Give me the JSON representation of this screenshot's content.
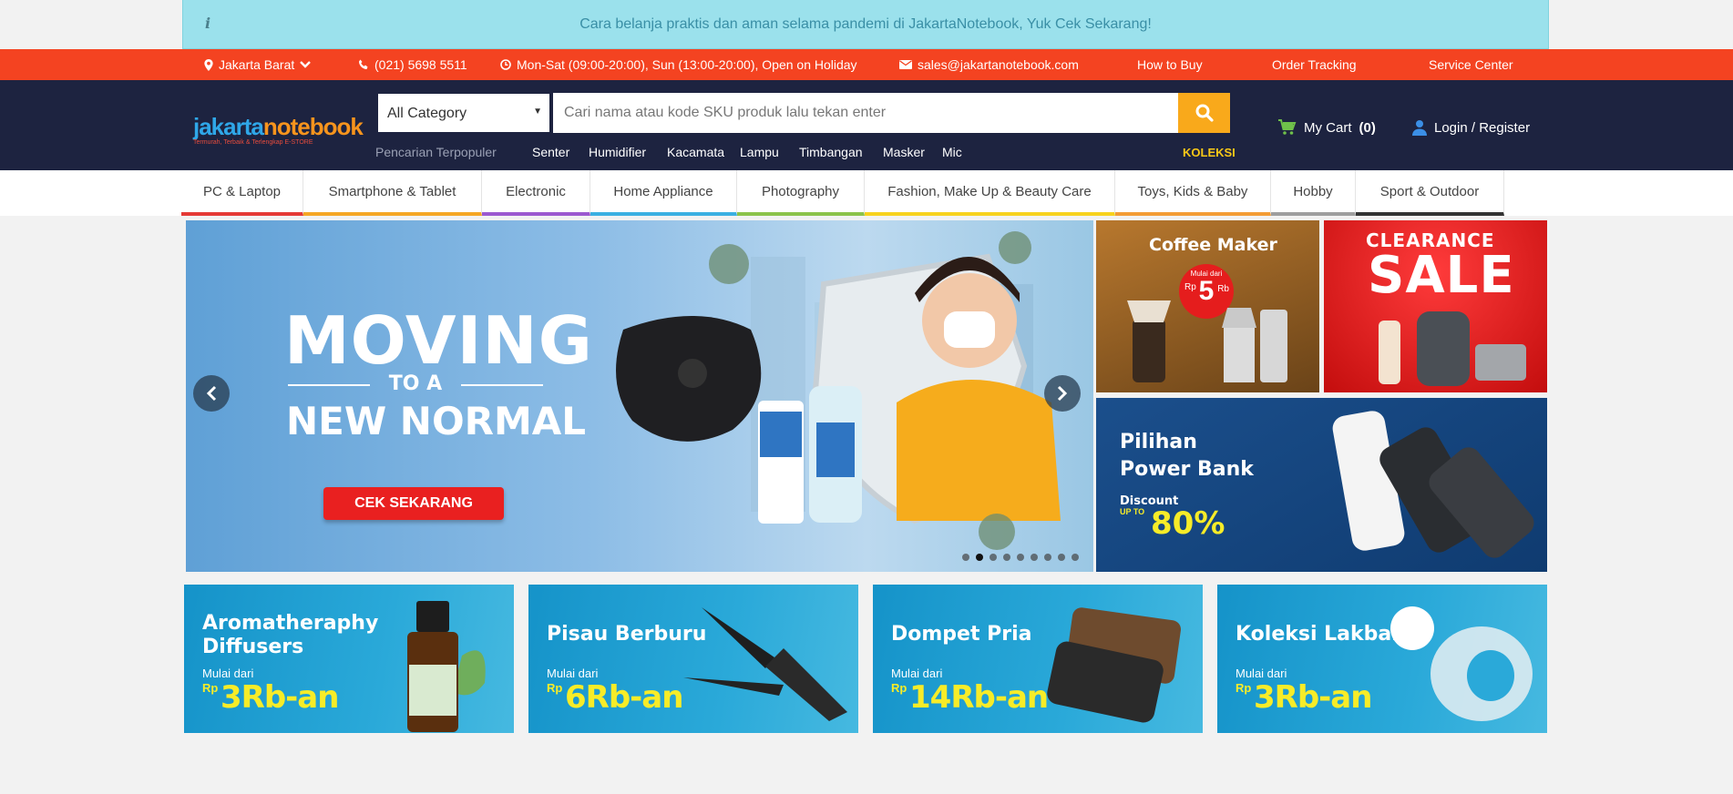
{
  "notice": {
    "info_icon": "i",
    "message": "Cara belanja praktis dan aman selama pandemi di JakartaNotebook, Yuk Cek Sekarang!"
  },
  "topbar": {
    "location": "Jakarta Barat",
    "phone": "(021) 5698 5511",
    "hours": "Mon-Sat (09:00-20:00), Sun (13:00-20:00), Open on Holiday",
    "email": "sales@jakartanotebook.com",
    "links": [
      "How to Buy",
      "Order Tracking",
      "Service Center"
    ]
  },
  "header": {
    "logo_part1": "jakarta",
    "logo_part2": "notebook",
    "logo_tagline": "Termurah, Terbaik & Terlengkap E-STORE",
    "category_selected": "All Category",
    "search_placeholder": "Cari nama atau kode SKU produk lalu tekan enter",
    "popular_label": "Pencarian Terpopuler",
    "popular_items": [
      "Senter",
      "Humidifier",
      "Kacamata",
      "Lampu",
      "Timbangan",
      "Masker",
      "Mic"
    ],
    "koleksi": "KOLEKSI",
    "cart": "My Cart",
    "cart_count": "(0)",
    "login": "Login / Register"
  },
  "nav": {
    "tabs": [
      {
        "label": "PC & Laptop",
        "color": "#e53935"
      },
      {
        "label": "Smartphone & Tablet",
        "color": "#f5a623"
      },
      {
        "label": "Electronic",
        "color": "#9b59d0"
      },
      {
        "label": "Home Appliance",
        "color": "#3ab0e2"
      },
      {
        "label": "Photography",
        "color": "#8bc34a"
      },
      {
        "label": "Fashion, Make Up & Beauty Care",
        "color": "#f7d21c"
      },
      {
        "label": "Toys, Kids & Baby",
        "color": "#f39c34"
      },
      {
        "label": "Hobby",
        "color": "#9e9e9e"
      },
      {
        "label": "Sport & Outdoor",
        "color": "#333333"
      }
    ]
  },
  "hero": {
    "line1": "MOVING",
    "line2": "TO A",
    "line3": "NEW NORMAL",
    "cta": "CEK SEKARANG",
    "slide_count": 9,
    "active_slide": 2
  },
  "side_banners": {
    "coffee": {
      "title": "Coffee Maker",
      "badge_top": "Mulai dari",
      "badge_rp": "Rp",
      "badge_val": "5",
      "badge_unit": "Rb"
    },
    "clearance": {
      "line1": "CLEARANCE",
      "line2": "SALE"
    },
    "powerbank": {
      "line1": "Pilihan",
      "line2": "Power Bank",
      "disc_label": "Discount",
      "upto": "UP TO",
      "disc_val": "80%"
    }
  },
  "promos": [
    {
      "title1": "Aromatheraphy",
      "title2": "Diffusers",
      "mulai": "Mulai dari",
      "rp": "Rp",
      "price": "3Rb-an"
    },
    {
      "title1": "Pisau Berburu",
      "title2": "",
      "mulai": "Mulai dari",
      "rp": "Rp",
      "price": "6Rb-an"
    },
    {
      "title1": "Dompet Pria",
      "title2": "",
      "mulai": "Mulai dari",
      "rp": "Rp",
      "price": "14Rb-an"
    },
    {
      "title1": "Koleksi Lakban",
      "title2": "",
      "mulai": "Mulai dari",
      "rp": "Rp",
      "price": "3Rb-an"
    }
  ]
}
